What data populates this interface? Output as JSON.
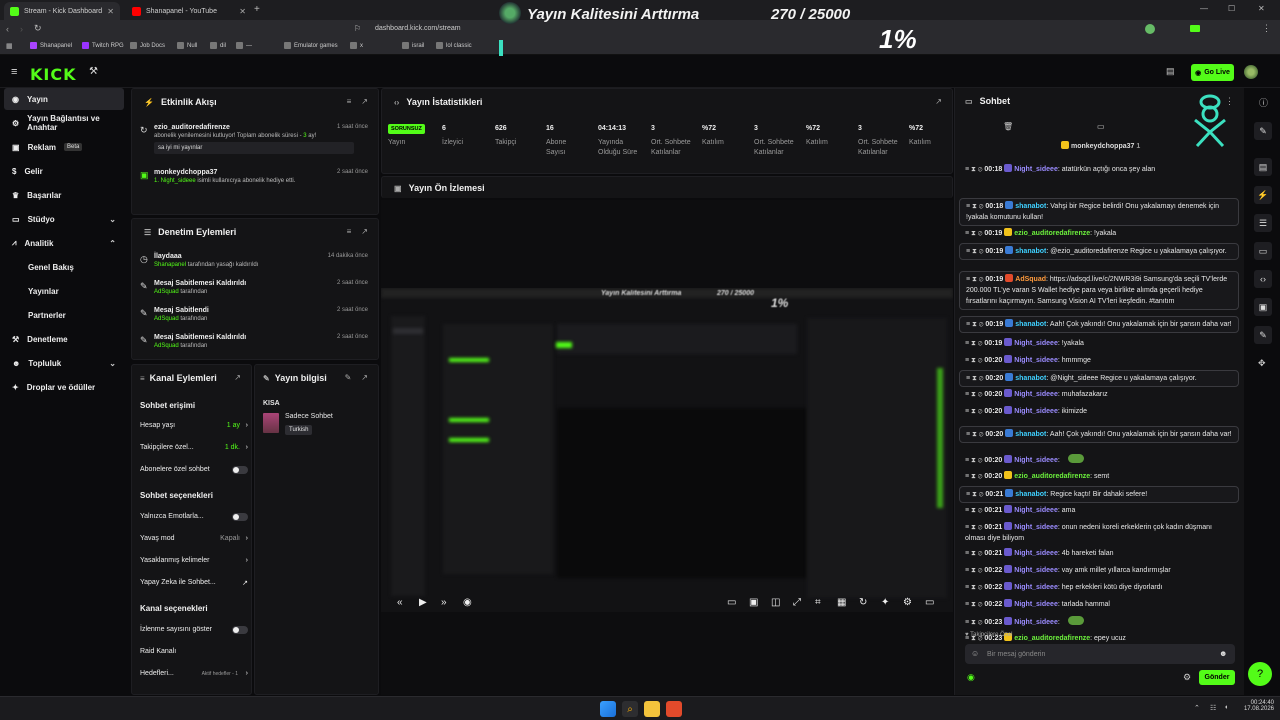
{
  "browser": {
    "tabs": [
      {
        "title": "Stream - Kick Dashboard",
        "active": true
      },
      {
        "title": "Shanapanel - YouTube",
        "active": false
      }
    ],
    "url": "dashboard.kick.com/stream",
    "bookmarks": [
      "Shanapanel",
      "Twitch RPG",
      "Job Docs",
      "Null",
      "dil",
      "—",
      "Emulator games",
      "x",
      "israil",
      "lol classic"
    ]
  },
  "overlay": {
    "title": "Yayın Kalitesini Arttırma",
    "count": "270 / 25000",
    "percent": "1%",
    "progress": 0.01
  },
  "header": {
    "logo": "KICK",
    "go_live": "Go Live"
  },
  "sidebar": {
    "items": [
      {
        "label": "Yayın",
        "active": true
      },
      {
        "label": "Yayın Bağlantısı ve Anahtar"
      },
      {
        "label": "Reklam",
        "badge": "Beta"
      },
      {
        "label": "Gelir"
      },
      {
        "label": "Başarılar"
      },
      {
        "label": "Stüdyo"
      },
      {
        "label": "Analitik"
      },
      {
        "label": "Denetleme"
      },
      {
        "label": "Topluluk"
      },
      {
        "label": "Droplar ve ödüller"
      }
    ],
    "analytics_sub": [
      "Genel Bakış",
      "Yayınlar",
      "Partnerler"
    ]
  },
  "activity": {
    "title": "Etkinlik Akışı",
    "items": [
      {
        "user": "ezio_auditoredafirenze",
        "time": "1 saat önce",
        "text_pre": "abonelik yenilemesini kutluyor! Toplam abonelik süresi - ",
        "months": "3",
        "text_post": " ay!",
        "message": "sa iyi mi yayınlar"
      },
      {
        "user": "monkeydchoppa37",
        "time": "2 saat önce",
        "gifted": "1. Night_sideee",
        "text": " isimli kullanıcıya abonelik hediye etti."
      }
    ]
  },
  "moderation": {
    "title": "Denetim Eylemleri",
    "items": [
      {
        "title": "İlaydaaa",
        "by": "Shanapanel",
        "rest": " tarafından yasağı kaldırıldı",
        "time": "14 dakika önce"
      },
      {
        "title": "Mesaj Sabitlemesi Kaldırıldı",
        "by": "AdSquad",
        "rest": " tarafından",
        "time": "2 saat önce"
      },
      {
        "title": "Mesaj Sabitlendi",
        "by": "AdSquad",
        "rest": " tarafından",
        "time": "2 saat önce"
      },
      {
        "title": "Mesaj Sabitlemesi Kaldırıldı",
        "by": "AdSquad",
        "rest": " tarafından",
        "time": "2 saat önce"
      }
    ]
  },
  "stats": {
    "title": "Yayın İstatistikleri",
    "status": "SORUNSUZ",
    "columns": [
      {
        "value": "",
        "label": "Yayın"
      },
      {
        "value": "6",
        "label": "İzleyici"
      },
      {
        "value": "626",
        "label": "Takipçi"
      },
      {
        "value": "16",
        "label": "Abone Sayısı"
      },
      {
        "value": "04:14:13",
        "label": "Yayında Olduğu Süre"
      },
      {
        "value": "3",
        "label": "Ort. Sohbete Katılanlar"
      },
      {
        "value": "%72",
        "label": "Katılım"
      },
      {
        "value": "3",
        "label": "Ort. Sohbete Katılanlar"
      },
      {
        "value": "%72",
        "label": "Katılım"
      },
      {
        "value": "3",
        "label": "Ort. Sohbete Katılanlar"
      },
      {
        "value": "%72",
        "label": "Katılım"
      }
    ]
  },
  "preview": {
    "title": "Yayın Ön İzlemesi"
  },
  "channel_actions": {
    "title": "Kanal Eylemleri",
    "chat_access": "Sohbet erişimi",
    "account_age": {
      "label": "Hesap yaşı",
      "value": "1 ay"
    },
    "followers_only": {
      "label": "Takipçilere özel...",
      "value": "1 dk."
    },
    "subs_only": "Abonelere özel sohbet",
    "chat_options": "Sohbet seçenekleri",
    "emotes_only": "Yalnızca Emotlarla...",
    "slow_mode": {
      "label": "Yavaş mod",
      "value": "Kapalı"
    },
    "banned_words": "Yasaklanmış kelimeler",
    "ai_chat": "Yapay Zeka ile Sohbet...",
    "channel_options": "Kanal seçenekleri",
    "show_viewers": "İzlenme sayısını göster",
    "raid": "Raid Kanalı",
    "targets": {
      "label": "Hedefleri...",
      "value": "Aktif hedefler - 1"
    }
  },
  "stream_info": {
    "title": "Yayın bilgisi",
    "tag": "KISA",
    "category": "Sadece Sohbet",
    "language": "Turkish"
  },
  "chat": {
    "title": "Sohbet",
    "pinned_user": "monkeydchoppa37",
    "pinned_count": "1",
    "messages": [
      {
        "time": "00:18",
        "user": "Night_sideee",
        "cls": "u-night",
        "text": "atatürkün açtığı onca şey alan"
      },
      {
        "time": "00:18",
        "user": "shanabot",
        "cls": "u-shana",
        "text": "Vahşi bir Regice belirdi! Onu yakalamayı denemek için !yakala komutunu kullan!",
        "boxed": true
      },
      {
        "time": "00:19",
        "user": "ezio_auditoredafirenze",
        "cls": "u-ezio",
        "text": "!yakala"
      },
      {
        "time": "00:19",
        "user": "shanabot",
        "cls": "u-shana",
        "text": "@ezio_auditoredafirenze Regice u yakalamaya çalışıyor.",
        "boxed": true
      },
      {
        "time": "00:19",
        "user": "AdSquad",
        "cls": "u-ad",
        "text": "https://adsqd.live/c/2NWR3i9i Samsung'da seçili TV'lerde 200.000 TL'ye varan S Wallet hediye para veya birlikte alımda geçerli hediye fırsatlarını kaçırmayın. Samsung Vision AI TV'leri keşfedin. #tanıtım",
        "boxed": true
      },
      {
        "time": "00:19",
        "user": "shanabot",
        "cls": "u-shana",
        "text": "Aah! Çok yakındı! Onu yakalamak için bir şansın daha var!",
        "boxed": true
      },
      {
        "time": "00:19",
        "user": "Night_sideee",
        "cls": "u-night",
        "text": "!yakala"
      },
      {
        "time": "00:20",
        "user": "Night_sideee",
        "cls": "u-night",
        "text": "hmmmge"
      },
      {
        "time": "00:20",
        "user": "shanabot",
        "cls": "u-shana",
        "text": "@Night_sideee Regice u yakalamaya çalışıyor.",
        "boxed": true
      },
      {
        "time": "00:20",
        "user": "Night_sideee",
        "cls": "u-night",
        "text": "muhafazakarız"
      },
      {
        "time": "00:20",
        "user": "Night_sideee",
        "cls": "u-night",
        "text": "ikimizde"
      },
      {
        "time": "00:20",
        "user": "shanabot",
        "cls": "u-shana",
        "text": "Aah! Çok yakındı! Onu yakalamak için bir şansın daha var!",
        "boxed": true
      },
      {
        "time": "00:20",
        "user": "Night_sideee",
        "cls": "u-night",
        "text": "",
        "emote": true
      },
      {
        "time": "00:20",
        "user": "ezio_auditoredafirenze",
        "cls": "u-ezio",
        "text": "semt"
      },
      {
        "time": "00:21",
        "user": "shanabot",
        "cls": "u-shana",
        "text": "Regice kaçtı! Bir dahaki sefere!",
        "boxed": true
      },
      {
        "time": "00:21",
        "user": "Night_sideee",
        "cls": "u-night",
        "text": "ama"
      },
      {
        "time": "00:21",
        "user": "Night_sideee",
        "cls": "u-night",
        "text": "onun nedeni koreli erkeklerin çok kadın düşmanı olması diye biliyom"
      },
      {
        "time": "00:21",
        "user": "Night_sideee",
        "cls": "u-night",
        "text": "4b hareketi falan"
      },
      {
        "time": "00:22",
        "user": "Night_sideee",
        "cls": "u-night",
        "text": "vay amk millet yıllarca kandırmışlar"
      },
      {
        "time": "00:22",
        "user": "Night_sideee",
        "cls": "u-night",
        "text": "hep erkekleri kötü diye diyorlardı"
      },
      {
        "time": "00:22",
        "user": "Night_sideee",
        "cls": "u-night",
        "text": "tarlada hammal"
      },
      {
        "time": "00:23",
        "user": "Night_sideee",
        "cls": "u-night",
        "text": "",
        "emote": true
      },
      {
        "time": "00:23",
        "user": "ezio_auditoredafirenze",
        "cls": "u-ezio",
        "text": "epey ucuz"
      }
    ],
    "followers_only_label": "Takipçilere Özel",
    "input_placeholder": "Bir mesaj gönderin",
    "send_label": "Gönder"
  },
  "taskbar": {
    "time": "00:24:40",
    "date": "17.08.2026"
  },
  "colors": {
    "accent": "#53fc18",
    "background": "#0b0b0d",
    "panel": "#141416"
  }
}
